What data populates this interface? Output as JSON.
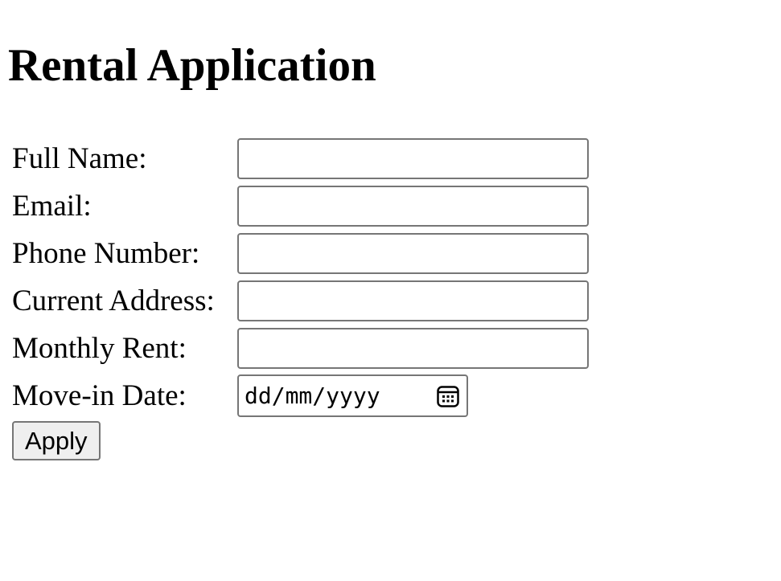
{
  "page": {
    "title": "Rental Application"
  },
  "form": {
    "fields": [
      {
        "label": "Full Name:",
        "value": "",
        "placeholder": ""
      },
      {
        "label": "Email:",
        "value": "",
        "placeholder": ""
      },
      {
        "label": "Phone Number:",
        "value": "",
        "placeholder": ""
      },
      {
        "label": "Current Address:",
        "value": "",
        "placeholder": ""
      },
      {
        "label": "Monthly Rent:",
        "value": "",
        "placeholder": ""
      }
    ],
    "move_in": {
      "label": "Move-in Date:",
      "placeholder": "dd/mm/yyyy",
      "icon": "calendar-icon"
    },
    "submit_label": "Apply"
  }
}
